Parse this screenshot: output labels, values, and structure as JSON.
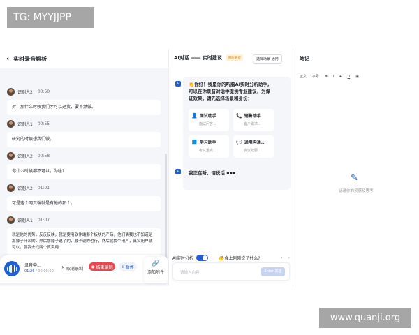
{
  "overlay": {
    "tag": "TG: MYYJJPP",
    "watermark": "www.quanji.org"
  },
  "left": {
    "title": "实时录音解析",
    "messages": [
      {
        "speaker": "识别人2",
        "time": "00:50",
        "lines": [
          "对，那什么时候我们才可以退货，要不然做。"
        ]
      },
      {
        "speaker": "识别人1",
        "time": "00:55",
        "lines": [
          "研究的时候想我们做。"
        ]
      },
      {
        "speaker": "识别人2",
        "time": "00:58",
        "lines": [
          "你什么时候都不可以，为啥?"
        ]
      },
      {
        "speaker": "识别人2",
        "time": "01:01",
        "lines": [
          "可是这个网页端就是有他的那个。"
        ]
      },
      {
        "speaker": "识别人1",
        "time": "01:07",
        "lines": [
          "就是他的优势，反反反映，就是要用软件端那个板块的产品，他们俩我也不知道是",
          "那脖子什么的，然后那脖子说了的，脖子说的也行，然后就找个用户，真实用户就",
          "可以，那我去找两个真实用"
        ]
      }
    ],
    "recorder": {
      "label": "录音中...",
      "elapsed": "01:26",
      "total": "/ 00:00:00",
      "cancel": "取消录制",
      "end": "结束录制",
      "pause": "暂停"
    },
    "attach": "添加附件"
  },
  "middle": {
    "title": "AI对话 —— 实时建议",
    "badge": "限时免费",
    "scene_button": "选择场景-通用",
    "ai_icon": "AI",
    "greeting": [
      "👏你好！我是你的听脑AI实时分析助手,",
      "可以在你录音对话中提供专业建议，为保",
      "证效果，请先选择场景和身份："
    ],
    "options": [
      {
        "icon": "👤",
        "title": "面试助手",
        "desc": "面试问答..."
      },
      {
        "icon": "📞",
        "title": "销售助手",
        "desc": "客户需求..."
      },
      {
        "icon": "📘",
        "title": "学习助手",
        "desc": "考试重点..."
      },
      {
        "icon": "💬",
        "title": "通用沟通...",
        "desc": "会议纪要..."
      }
    ],
    "listening": "我正在听，请说话 ▪▪▪",
    "footer": {
      "toggle_label": "AI实时分析",
      "hint": "🤔会上刚刚说了什么?",
      "prev": "‹",
      "next": "›"
    },
    "input": {
      "placeholder": "请输入内容",
      "send": "Enter 发送"
    }
  },
  "right": {
    "title": "笔记",
    "toolbar": {
      "style": "正文",
      "size": "字号",
      "bold": "B",
      "italic": "I",
      "strike": "S",
      "underline": "U",
      "image": "▣"
    },
    "empty_text": "记录你的灵感及思考"
  }
}
